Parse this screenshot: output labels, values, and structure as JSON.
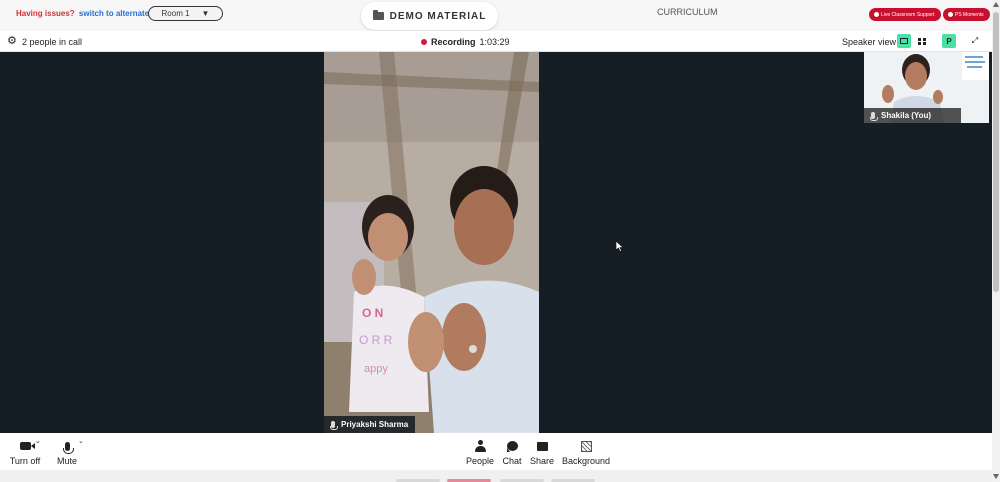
{
  "topbar": {
    "issue_text": "Having issues?",
    "switch_link": "switch to alternate room",
    "room_value": "Room 1",
    "demo_material": "DEMO MATERIAL",
    "curriculum": "CURRICULUM",
    "live_support": "Live Classroom Support",
    "ps_moments": "PS Moments",
    "brand_color": "#c8102e"
  },
  "call": {
    "people_count": "2 people in call",
    "recording_label": "Recording",
    "recording_time": "1:03:29",
    "view_label": "Speaker view",
    "participant_initial": "P"
  },
  "videos": {
    "main_name": "Priyakshi Sharma",
    "self_name": "Shakila (You)"
  },
  "toolbar": {
    "turn_off": "Turn off",
    "mute": "Mute",
    "people": "People",
    "chat": "Chat",
    "share": "Share",
    "background": "Background"
  },
  "icons": [
    "folder-icon",
    "gear-icon",
    "camera-icon",
    "microphone-icon",
    "people-icon",
    "chat-icon",
    "share-icon",
    "background-icon",
    "speaker-view-icon",
    "grid-view-icon",
    "fullscreen-icon"
  ]
}
